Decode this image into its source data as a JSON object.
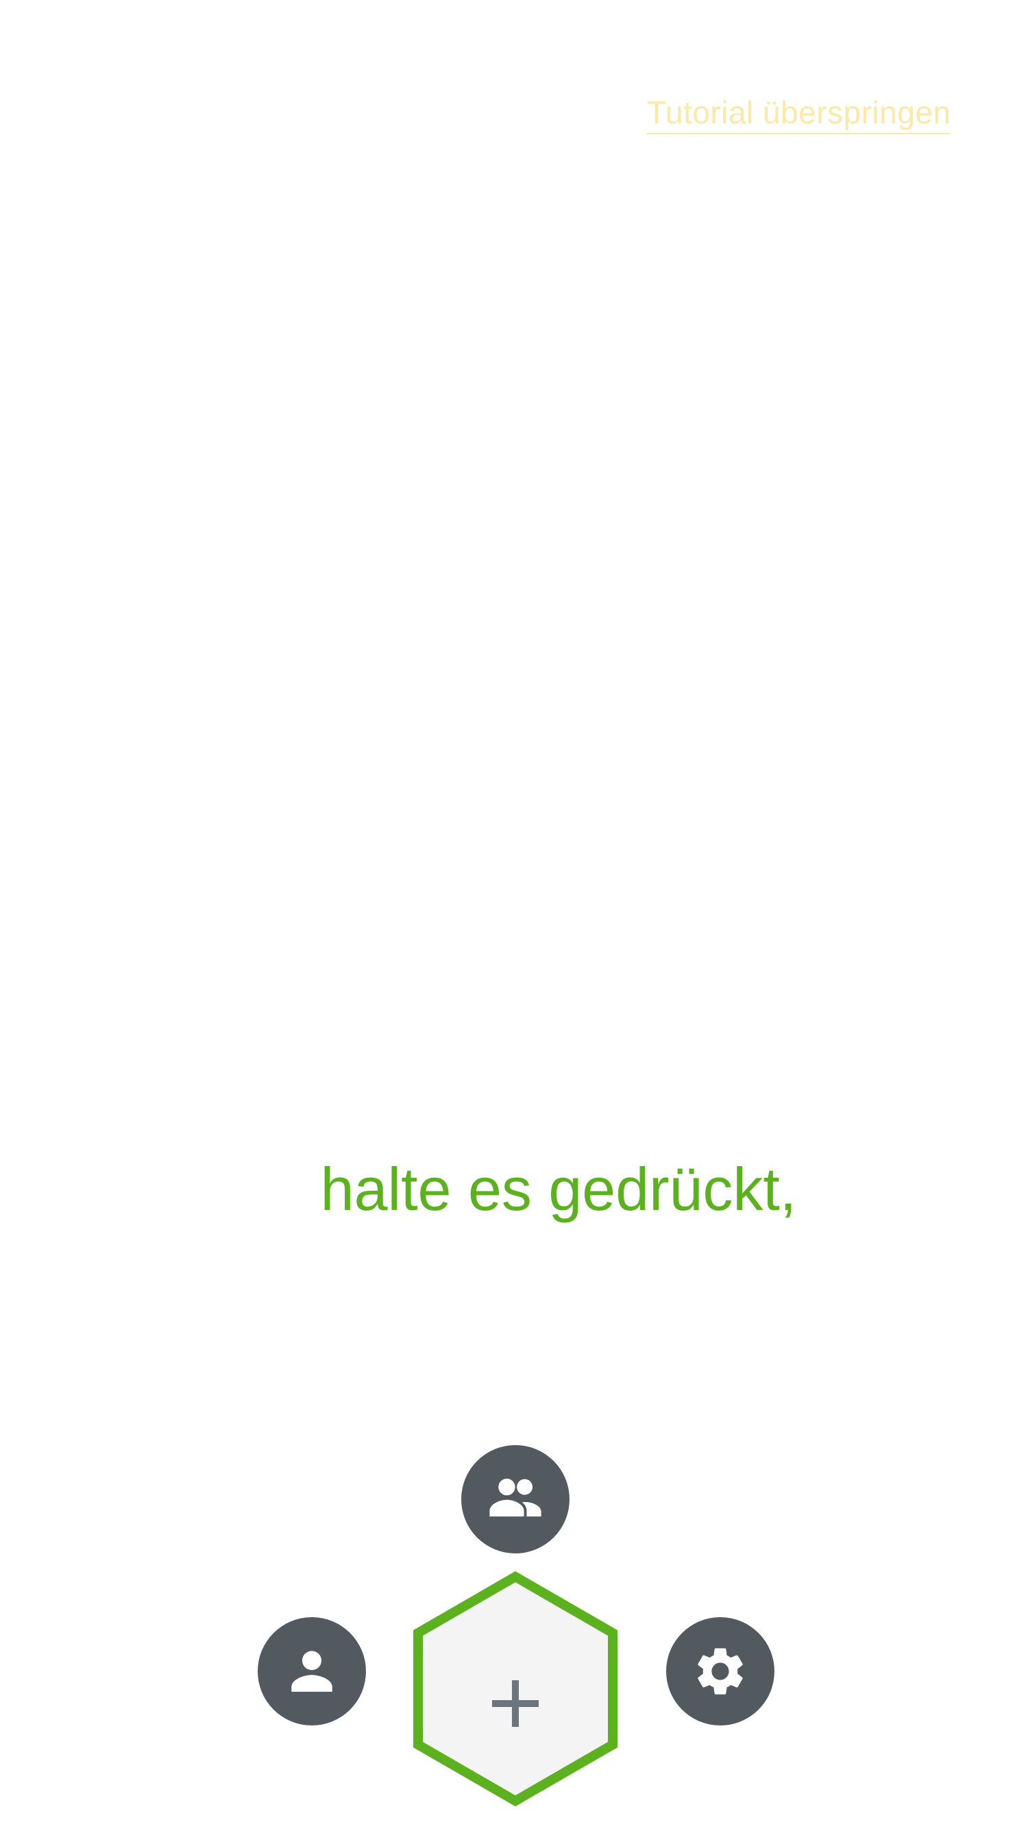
{
  "header": {
    "skip_tutorial_label": "Tutorial überspringen"
  },
  "tutorial": {
    "hint_text": "halte es gedrückt,"
  },
  "bottom_menu": {
    "friends_icon": "group-icon",
    "profile_icon": "person-icon",
    "settings_icon": "gear-icon",
    "add_icon": "plus-icon"
  },
  "colors": {
    "accent_green": "#5cb21e",
    "skip_link": "#fbe9a8",
    "icon_button_bg": "#525a5f",
    "hex_fill": "#f4f4f4",
    "plus_color": "#6c757b"
  }
}
